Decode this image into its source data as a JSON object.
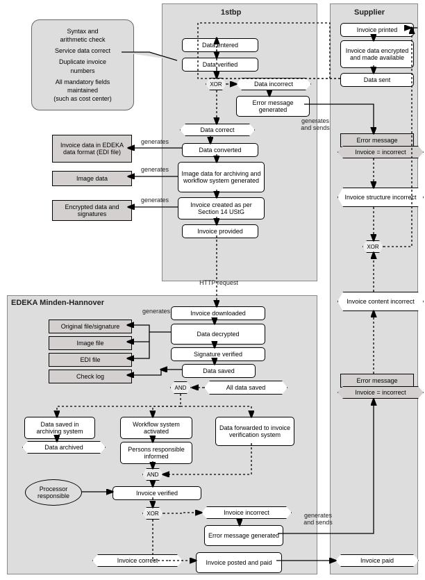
{
  "lanes": {
    "first": "1stbp",
    "supplier": "Supplier",
    "edeka": "EDEKA Minden-Hannover"
  },
  "callout": [
    "Syntax and",
    "arithmetic check",
    "",
    "Service data correct",
    "",
    "Duplicate invoice",
    "numbers",
    "",
    "All mandatory fields",
    "maintained",
    "(such as cost center)"
  ],
  "first": {
    "dataEntered": "Data entered",
    "dataVerified": "Data verified",
    "xor": "XOR",
    "dataIncorrect": "Data incorrect",
    "errorGenerated": "Error message generated",
    "dataCorrect": "Data correct",
    "dataConverted": "Data converted",
    "imageData": "Image data for archiving and workflow system generated",
    "invoiceCreated": "Invoice created as per Section 14 UStG",
    "invoiceProvided": "Invoice provided"
  },
  "firstOutputs": {
    "edi": "Invoice data in EDEKA data format (EDI file)",
    "image": "Image data",
    "encrypted": "Encrypted data and signatures"
  },
  "labels": {
    "generates": "generates",
    "genSends": "generates and sends",
    "httpReq": "HTTP request"
  },
  "edeka": {
    "invoiceDownloaded": "Invoice downloaded",
    "dataDecrypted": "Data decrypted",
    "sigVerified": "Signature verified",
    "dataSaved": "Data saved",
    "allSaved": "All data saved",
    "and": "AND",
    "archSaved": "Data saved in archiving system",
    "archived": "Data archived",
    "wfActivated": "Workflow system activated",
    "personsInformed": "Persons responsible informed",
    "dataFwd": "Data forwarded to invoice verification system",
    "invoiceVerified": "Invoice verified",
    "xor": "XOR",
    "invIncorrect": "Invoice incorrect",
    "errGen2": "Error message generated",
    "invCorrect": "Invoice correct",
    "posted": "Invoice posted and paid",
    "paid": "Invoice paid",
    "processor": "Processor responsible"
  },
  "edekaOutputs": {
    "orig": "Original file/signature",
    "img": "Image file",
    "edi": "EDI file",
    "check": "Check log"
  },
  "supplier": {
    "printed": "Invoice printed",
    "encrypted": "Invoice data encrypted and made available",
    "sent": "Data sent",
    "errMsg": "Error message",
    "invIncorrect": "Invoice = incorrect",
    "structIncorrect": "Invoice structure incorrect",
    "xor": "XOR",
    "contentIncorrect": "Invoice content incorrect",
    "errMsg2": "Error message",
    "invIncorrect2": "Invoice = incorrect"
  }
}
